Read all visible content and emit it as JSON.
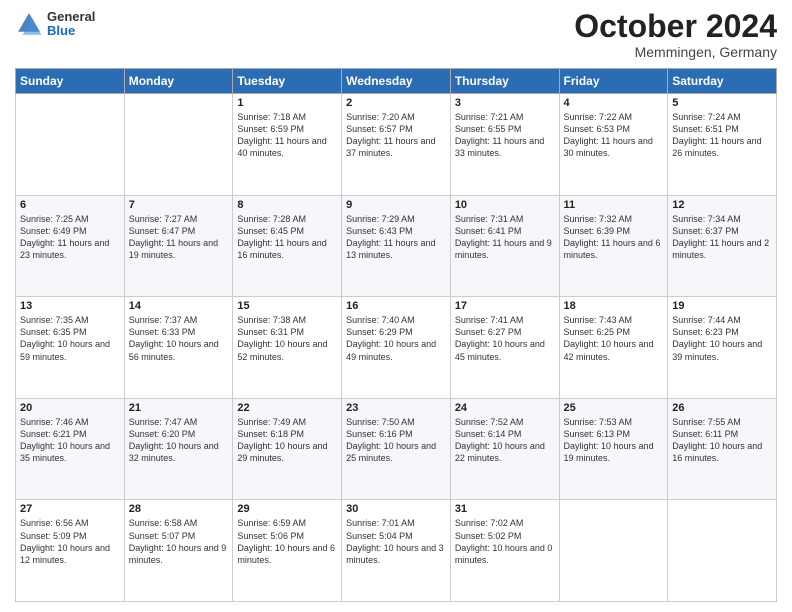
{
  "header": {
    "logo": {
      "general": "General",
      "blue": "Blue"
    },
    "title": "October 2024",
    "location": "Memmingen, Germany"
  },
  "weekdays": [
    "Sunday",
    "Monday",
    "Tuesday",
    "Wednesday",
    "Thursday",
    "Friday",
    "Saturday"
  ],
  "weeks": [
    [
      {
        "day": "",
        "sunrise": "",
        "sunset": "",
        "daylight": ""
      },
      {
        "day": "",
        "sunrise": "",
        "sunset": "",
        "daylight": ""
      },
      {
        "day": "1",
        "sunrise": "Sunrise: 7:18 AM",
        "sunset": "Sunset: 6:59 PM",
        "daylight": "Daylight: 11 hours and 40 minutes."
      },
      {
        "day": "2",
        "sunrise": "Sunrise: 7:20 AM",
        "sunset": "Sunset: 6:57 PM",
        "daylight": "Daylight: 11 hours and 37 minutes."
      },
      {
        "day": "3",
        "sunrise": "Sunrise: 7:21 AM",
        "sunset": "Sunset: 6:55 PM",
        "daylight": "Daylight: 11 hours and 33 minutes."
      },
      {
        "day": "4",
        "sunrise": "Sunrise: 7:22 AM",
        "sunset": "Sunset: 6:53 PM",
        "daylight": "Daylight: 11 hours and 30 minutes."
      },
      {
        "day": "5",
        "sunrise": "Sunrise: 7:24 AM",
        "sunset": "Sunset: 6:51 PM",
        "daylight": "Daylight: 11 hours and 26 minutes."
      }
    ],
    [
      {
        "day": "6",
        "sunrise": "Sunrise: 7:25 AM",
        "sunset": "Sunset: 6:49 PM",
        "daylight": "Daylight: 11 hours and 23 minutes."
      },
      {
        "day": "7",
        "sunrise": "Sunrise: 7:27 AM",
        "sunset": "Sunset: 6:47 PM",
        "daylight": "Daylight: 11 hours and 19 minutes."
      },
      {
        "day": "8",
        "sunrise": "Sunrise: 7:28 AM",
        "sunset": "Sunset: 6:45 PM",
        "daylight": "Daylight: 11 hours and 16 minutes."
      },
      {
        "day": "9",
        "sunrise": "Sunrise: 7:29 AM",
        "sunset": "Sunset: 6:43 PM",
        "daylight": "Daylight: 11 hours and 13 minutes."
      },
      {
        "day": "10",
        "sunrise": "Sunrise: 7:31 AM",
        "sunset": "Sunset: 6:41 PM",
        "daylight": "Daylight: 11 hours and 9 minutes."
      },
      {
        "day": "11",
        "sunrise": "Sunrise: 7:32 AM",
        "sunset": "Sunset: 6:39 PM",
        "daylight": "Daylight: 11 hours and 6 minutes."
      },
      {
        "day": "12",
        "sunrise": "Sunrise: 7:34 AM",
        "sunset": "Sunset: 6:37 PM",
        "daylight": "Daylight: 11 hours and 2 minutes."
      }
    ],
    [
      {
        "day": "13",
        "sunrise": "Sunrise: 7:35 AM",
        "sunset": "Sunset: 6:35 PM",
        "daylight": "Daylight: 10 hours and 59 minutes."
      },
      {
        "day": "14",
        "sunrise": "Sunrise: 7:37 AM",
        "sunset": "Sunset: 6:33 PM",
        "daylight": "Daylight: 10 hours and 56 minutes."
      },
      {
        "day": "15",
        "sunrise": "Sunrise: 7:38 AM",
        "sunset": "Sunset: 6:31 PM",
        "daylight": "Daylight: 10 hours and 52 minutes."
      },
      {
        "day": "16",
        "sunrise": "Sunrise: 7:40 AM",
        "sunset": "Sunset: 6:29 PM",
        "daylight": "Daylight: 10 hours and 49 minutes."
      },
      {
        "day": "17",
        "sunrise": "Sunrise: 7:41 AM",
        "sunset": "Sunset: 6:27 PM",
        "daylight": "Daylight: 10 hours and 45 minutes."
      },
      {
        "day": "18",
        "sunrise": "Sunrise: 7:43 AM",
        "sunset": "Sunset: 6:25 PM",
        "daylight": "Daylight: 10 hours and 42 minutes."
      },
      {
        "day": "19",
        "sunrise": "Sunrise: 7:44 AM",
        "sunset": "Sunset: 6:23 PM",
        "daylight": "Daylight: 10 hours and 39 minutes."
      }
    ],
    [
      {
        "day": "20",
        "sunrise": "Sunrise: 7:46 AM",
        "sunset": "Sunset: 6:21 PM",
        "daylight": "Daylight: 10 hours and 35 minutes."
      },
      {
        "day": "21",
        "sunrise": "Sunrise: 7:47 AM",
        "sunset": "Sunset: 6:20 PM",
        "daylight": "Daylight: 10 hours and 32 minutes."
      },
      {
        "day": "22",
        "sunrise": "Sunrise: 7:49 AM",
        "sunset": "Sunset: 6:18 PM",
        "daylight": "Daylight: 10 hours and 29 minutes."
      },
      {
        "day": "23",
        "sunrise": "Sunrise: 7:50 AM",
        "sunset": "Sunset: 6:16 PM",
        "daylight": "Daylight: 10 hours and 25 minutes."
      },
      {
        "day": "24",
        "sunrise": "Sunrise: 7:52 AM",
        "sunset": "Sunset: 6:14 PM",
        "daylight": "Daylight: 10 hours and 22 minutes."
      },
      {
        "day": "25",
        "sunrise": "Sunrise: 7:53 AM",
        "sunset": "Sunset: 6:13 PM",
        "daylight": "Daylight: 10 hours and 19 minutes."
      },
      {
        "day": "26",
        "sunrise": "Sunrise: 7:55 AM",
        "sunset": "Sunset: 6:11 PM",
        "daylight": "Daylight: 10 hours and 16 minutes."
      }
    ],
    [
      {
        "day": "27",
        "sunrise": "Sunrise: 6:56 AM",
        "sunset": "Sunset: 5:09 PM",
        "daylight": "Daylight: 10 hours and 12 minutes."
      },
      {
        "day": "28",
        "sunrise": "Sunrise: 6:58 AM",
        "sunset": "Sunset: 5:07 PM",
        "daylight": "Daylight: 10 hours and 9 minutes."
      },
      {
        "day": "29",
        "sunrise": "Sunrise: 6:59 AM",
        "sunset": "Sunset: 5:06 PM",
        "daylight": "Daylight: 10 hours and 6 minutes."
      },
      {
        "day": "30",
        "sunrise": "Sunrise: 7:01 AM",
        "sunset": "Sunset: 5:04 PM",
        "daylight": "Daylight: 10 hours and 3 minutes."
      },
      {
        "day": "31",
        "sunrise": "Sunrise: 7:02 AM",
        "sunset": "Sunset: 5:02 PM",
        "daylight": "Daylight: 10 hours and 0 minutes."
      },
      {
        "day": "",
        "sunrise": "",
        "sunset": "",
        "daylight": ""
      },
      {
        "day": "",
        "sunrise": "",
        "sunset": "",
        "daylight": ""
      }
    ]
  ]
}
